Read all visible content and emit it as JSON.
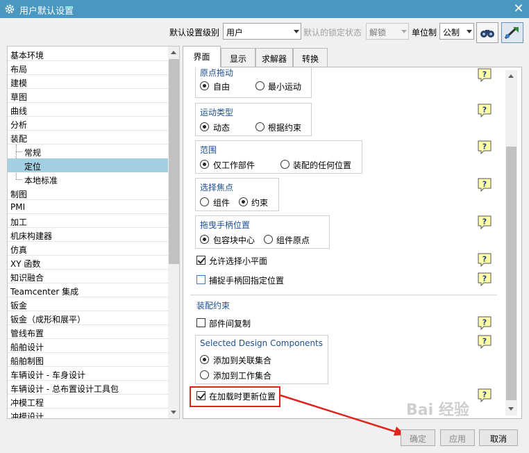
{
  "title": "用户默认设置",
  "toolbar": {
    "level_label": "默认设置级别",
    "level_value": "用户",
    "lock_label": "默认的锁定状态",
    "lock_value": "解锁",
    "unit_label": "单位制",
    "unit_value": "公制"
  },
  "tree": {
    "items": [
      {
        "label": "基本环境",
        "level": 0
      },
      {
        "label": "布局",
        "level": 0
      },
      {
        "label": "建模",
        "level": 0
      },
      {
        "label": "草图",
        "level": 0
      },
      {
        "label": "曲线",
        "level": 0
      },
      {
        "label": "分析",
        "level": 0
      },
      {
        "label": "装配",
        "level": 0
      },
      {
        "label": "常规",
        "level": 1
      },
      {
        "label": "定位",
        "level": 1,
        "selected": true
      },
      {
        "label": "本地标准",
        "level": 1
      },
      {
        "label": "制图",
        "level": 0
      },
      {
        "label": "PMI",
        "level": 0
      },
      {
        "label": "加工",
        "level": 0
      },
      {
        "label": "机床构建器",
        "level": 0
      },
      {
        "label": "仿真",
        "level": 0
      },
      {
        "label": "XY 函数",
        "level": 0
      },
      {
        "label": "知识融合",
        "level": 0
      },
      {
        "label": "Teamcenter 集成",
        "level": 0
      },
      {
        "label": "钣金",
        "level": 0
      },
      {
        "label": "钣金（成形和展平）",
        "level": 0
      },
      {
        "label": "管线布置",
        "level": 0
      },
      {
        "label": "船舶设计",
        "level": 0
      },
      {
        "label": "船舶制图",
        "level": 0
      },
      {
        "label": "车辆设计 - 车身设计",
        "level": 0
      },
      {
        "label": "车辆设计 - 总布置设计工具包",
        "level": 0
      },
      {
        "label": "冲模工程",
        "level": 0
      },
      {
        "label": "冲模设计",
        "level": 0
      }
    ]
  },
  "tabs": [
    {
      "label": "界面",
      "active": true
    },
    {
      "label": "显示"
    },
    {
      "label": "求解器"
    },
    {
      "label": "转换"
    }
  ],
  "panel": {
    "origin_drag": {
      "title": "原点拖动",
      "opt1": "自由",
      "opt2": "最小运动",
      "selected": "opt1"
    },
    "motion_type": {
      "title": "运动类型",
      "opt1": "动态",
      "opt2": "根据约束",
      "selected": "opt1"
    },
    "scope": {
      "title": "范围",
      "opt1": "仅工作部件",
      "opt2": "装配的任何位置",
      "selected": "opt1"
    },
    "select_focus": {
      "title": "选择焦点",
      "opt1": "组件",
      "opt2": "约束",
      "selected": "opt2"
    },
    "drag_handle": {
      "title": "拖曳手柄位置",
      "opt1": "包容块中心",
      "opt2": "组件原点",
      "selected": "opt1"
    },
    "allow_small_plane": {
      "label": "允许选择小平面",
      "checked": true
    },
    "snap_handle": {
      "label": "捕捉手柄回指定位置",
      "checked": false
    },
    "assembly_constraints": {
      "title": "装配约束",
      "copy_between": {
        "label": "部件间复制",
        "checked": false
      },
      "design_components": {
        "title": "Selected Design Components",
        "opt1": "添加到关联集合",
        "opt2": "添加到工作集合",
        "selected": "opt1"
      },
      "update_on_load": {
        "label": "在加载时更新位置",
        "checked": true
      }
    }
  },
  "buttons": {
    "ok": "确定",
    "apply": "应用",
    "cancel": "取消"
  },
  "watermark": "Bai 经验",
  "colors": {
    "titlebar": "#4a98bf",
    "selection": "#a3cfe0",
    "group_title": "#1d4f91",
    "annotation": "#e0231c"
  }
}
